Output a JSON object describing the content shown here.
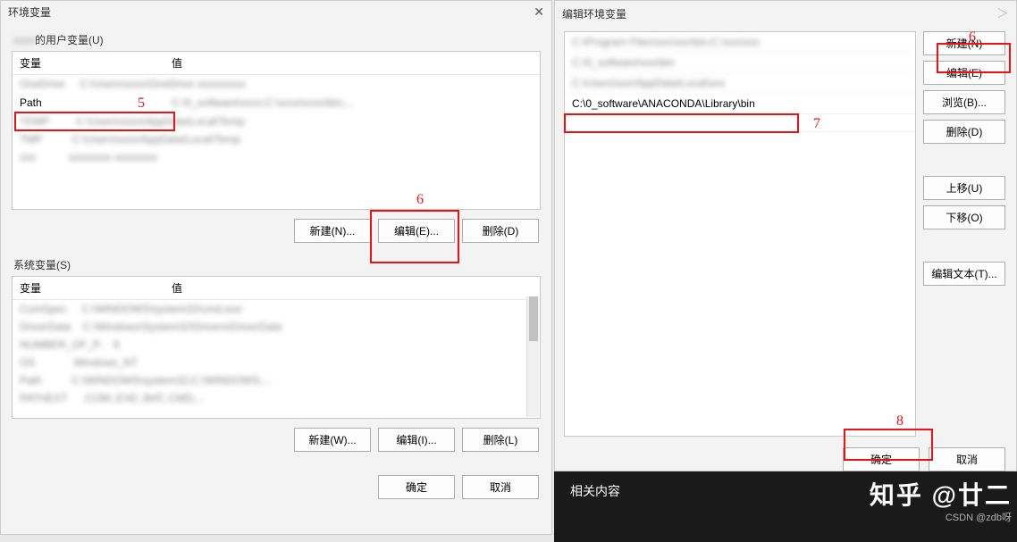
{
  "left": {
    "title": "环境变量",
    "userVarsLabel": "的用户变量(U)",
    "sysVarsLabel": "系统变量(S)",
    "colVar": "变量",
    "colVal": "值",
    "path_var": "Path",
    "buttons": {
      "newN": "新建(N)...",
      "editE": "编辑(E)...",
      "delD": "删除(D)",
      "newW": "新建(W)...",
      "editI": "编辑(I)...",
      "delL": "删除(L)",
      "ok": "确定",
      "cancel": "取消"
    }
  },
  "right": {
    "title": "编辑环境变量",
    "entry": "C:\\0_software\\ANACONDA\\Library\\bin",
    "buttons": {
      "new": "新建(N)",
      "edit": "编辑(E)",
      "browse": "浏览(B)...",
      "del": "删除(D)",
      "up": "上移(U)",
      "down": "下移(O)",
      "editText": "编辑文本(T)...",
      "ok": "确定",
      "cancel": "取消"
    }
  },
  "annotations": {
    "n5": "5",
    "n6a": "6",
    "n6b": "6",
    "n7": "7",
    "n8": "8"
  },
  "zhihu": {
    "related": "相关内容",
    "watermark": "知乎 @廿二",
    "csdn": "CSDN @zdb呀"
  }
}
